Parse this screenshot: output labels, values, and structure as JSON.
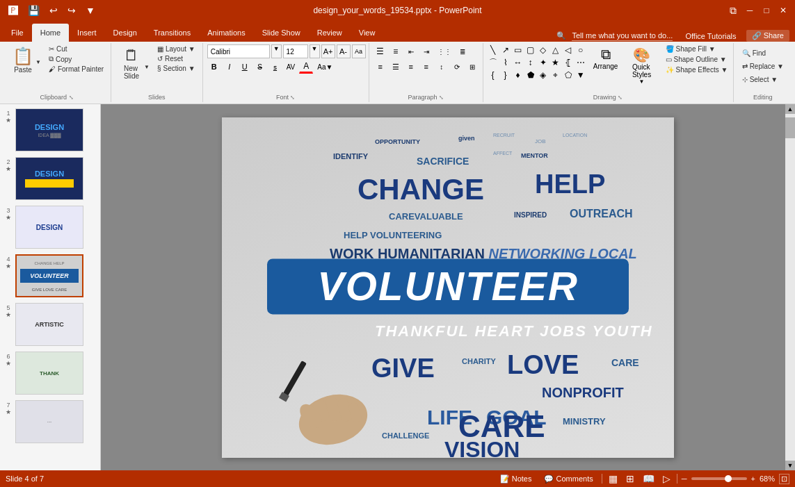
{
  "titlebar": {
    "filename": "design_your_words_19534.pptx - PowerPoint",
    "save_icon": "💾",
    "undo_icon": "↩",
    "redo_icon": "↪",
    "customize_icon": "⚙"
  },
  "ribbon_tabs": {
    "tabs": [
      "File",
      "Home",
      "Insert",
      "Design",
      "Transitions",
      "Animations",
      "Slide Show",
      "Review",
      "View"
    ],
    "active": "Home",
    "right_items": [
      "Tell me what you want to do...",
      "Office Tutorials",
      "Share"
    ]
  },
  "ribbon": {
    "groups": {
      "clipboard": {
        "label": "Clipboard",
        "paste_label": "Paste",
        "cut_label": "Cut",
        "copy_label": "Copy",
        "format_painter_label": "Format Painter"
      },
      "slides": {
        "label": "Slides",
        "new_slide_label": "New Slide",
        "layout_label": "Layout",
        "reset_label": "Reset",
        "section_label": "Section"
      },
      "font": {
        "label": "Font",
        "font_name": "Calibri",
        "font_size": "12",
        "bold": "B",
        "italic": "I",
        "underline": "U",
        "strikethrough": "S",
        "shadow": "s",
        "char_spacing": "AV"
      },
      "paragraph": {
        "label": "Paragraph"
      },
      "drawing": {
        "label": "Drawing",
        "arrange_label": "Arrange",
        "quick_styles_label": "Quick Styles",
        "shape_fill_label": "Shape Fill",
        "shape_outline_label": "Shape Outline",
        "shape_effects_label": "Shape Effects"
      },
      "editing": {
        "label": "Editing",
        "find_label": "Find",
        "replace_label": "Replace",
        "select_label": "Select"
      }
    }
  },
  "slides": [
    {
      "num": "1",
      "starred": true,
      "type": "design1",
      "label": "DESIGN"
    },
    {
      "num": "2",
      "starred": true,
      "type": "design2",
      "label": "DESIGN"
    },
    {
      "num": "3",
      "starred": true,
      "type": "design3",
      "label": "DESIGN"
    },
    {
      "num": "4",
      "starred": true,
      "type": "volunteer",
      "label": "VOLUNTEER",
      "active": true
    },
    {
      "num": "5",
      "starred": true,
      "type": "artistic",
      "label": "ARTISTIC"
    },
    {
      "num": "6",
      "starred": true,
      "type": "thank",
      "label": "THANK"
    },
    {
      "num": "7",
      "starred": true,
      "type": "thumb7",
      "label": ""
    }
  ],
  "statusbar": {
    "slide_info": "Slide 4 of 7",
    "notes_label": "Notes",
    "comments_label": "Comments",
    "zoom_level": "68%",
    "zoom_value": 68
  }
}
